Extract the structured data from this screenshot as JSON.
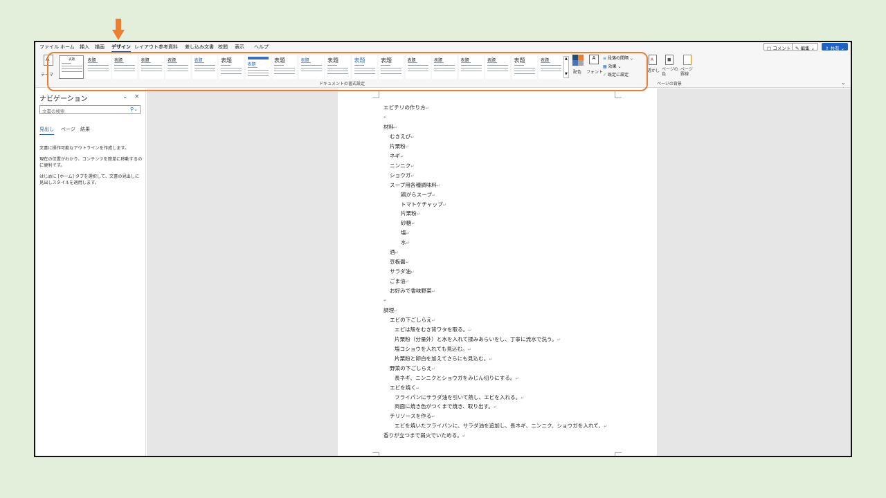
{
  "menu": {
    "items": [
      "ファイル",
      "ホーム",
      "挿入",
      "描画",
      "デザイン",
      "レイアウト",
      "参考資料",
      "差し込み文書",
      "校閲",
      "表示",
      "ヘルプ"
    ],
    "active_index": 4
  },
  "header_right": {
    "comment": "コメント",
    "edit": "編集",
    "share": "共有"
  },
  "ribbon": {
    "theme_label": "テーマ",
    "style_thumbs": [
      {
        "title": "表題",
        "kind": "sel"
      },
      {
        "title": "表題",
        "kind": "lines"
      },
      {
        "title": "表題",
        "kind": "lines"
      },
      {
        "title": "表題",
        "kind": "lines"
      },
      {
        "title": "表題",
        "kind": "lines"
      },
      {
        "title": "表題",
        "kind": "blue"
      },
      {
        "title": "表題",
        "kind": "big"
      },
      {
        "title": "表題",
        "kind": "bar"
      },
      {
        "title": "表題",
        "kind": "big"
      },
      {
        "title": "表題",
        "kind": "blue"
      },
      {
        "title": "表題",
        "kind": "big"
      },
      {
        "title": "表題",
        "kind": "bigblue"
      },
      {
        "title": "表題",
        "kind": "big"
      },
      {
        "title": "表題",
        "kind": "lines"
      },
      {
        "title": "表題",
        "kind": "lines"
      },
      {
        "title": "表題",
        "kind": "lines"
      },
      {
        "title": "表題",
        "kind": "lines"
      },
      {
        "title": "表題",
        "kind": "big"
      },
      {
        "title": "表題",
        "kind": "lines"
      }
    ],
    "colors_label": "配色",
    "fonts_label": "フォント",
    "paragraph_spacing": "段落の間隔",
    "effects": "効果",
    "set_default": "既定に設定",
    "doc_format_group": "ドキュメントの書式設定",
    "watermark": "透かし",
    "page_color": "ページの色",
    "page_borders": "ページ罫線",
    "page_bg_group": "ページの背景",
    "accent_color": "#ed7d31"
  },
  "nav": {
    "title": "ナビゲーション",
    "search_placeholder": "文書の検索",
    "tabs": [
      "見出し",
      "ページ",
      "結果"
    ],
    "text1": "文書に操作可能なアウトラインを作成します。",
    "text2": "現在の位置がわかり、コンテンツを簡単に移動するのに便利です。",
    "text3": "はじめに [ホーム] タブを選択して、文書の見出しに見出しスタイルを適用します。"
  },
  "doc": {
    "lines": [
      {
        "t": "エビチリの作り方",
        "i": 0
      },
      {
        "t": "",
        "i": 0
      },
      {
        "t": "材料",
        "i": 0
      },
      {
        "t": "むきえび",
        "i": 1
      },
      {
        "t": "片栗粉",
        "i": 1
      },
      {
        "t": "ネギ",
        "i": 1
      },
      {
        "t": "ニンニク",
        "i": 1
      },
      {
        "t": "ショウガ",
        "i": 1
      },
      {
        "t": "スープ用各種調味料",
        "i": 1
      },
      {
        "t": "鶏がらスープ",
        "i": 2
      },
      {
        "t": "トマトケチャップ",
        "i": 2
      },
      {
        "t": "片栗粉",
        "i": 2
      },
      {
        "t": "砂糖",
        "i": 2
      },
      {
        "t": "塩",
        "i": 2
      },
      {
        "t": "水",
        "i": 2
      },
      {
        "t": "酒",
        "i": 1
      },
      {
        "t": "豆板醤",
        "i": 1
      },
      {
        "t": "サラダ油",
        "i": 1
      },
      {
        "t": "ごま油",
        "i": 1
      },
      {
        "t": "お好みで香味野菜",
        "i": 1
      },
      {
        "t": "",
        "i": 0
      },
      {
        "t": "調理",
        "i": 0
      },
      {
        "t": "エビの下ごしらえ",
        "i": 1
      },
      {
        "t": "エビは殻をむき背ワタを取る。",
        "i": 3
      },
      {
        "t": "片栗粉（分量外）と水を入れて揉みあらいをし、丁寧に流水で洗う。",
        "i": 3
      },
      {
        "t": "塩コショウを入れても見込む。",
        "i": 3
      },
      {
        "t": "片栗粉と卵白を加えてさらにも見込む。",
        "i": 3
      },
      {
        "t": "野菜の下ごしらえ",
        "i": 1
      },
      {
        "t": "長ネギ、ニンニクとショウガをみじん切りにする。",
        "i": 3
      },
      {
        "t": "エビを焼く",
        "i": 1
      },
      {
        "t": "フライパンにサラダ油を引いて熱し、エビを入れる。",
        "i": 3
      },
      {
        "t": "両面に焼き色がつくまで焼き、取り出す。",
        "i": 3
      },
      {
        "t": "チリソースを作る",
        "i": 1
      },
      {
        "t": "エビを焼いたフライパンに、サラダ油を追加し、長ネギ、ニンニク、ショウガを入れて、",
        "i": 3
      },
      {
        "t": "香りが立つまで弱火でいためる。",
        "i": 0
      }
    ]
  }
}
